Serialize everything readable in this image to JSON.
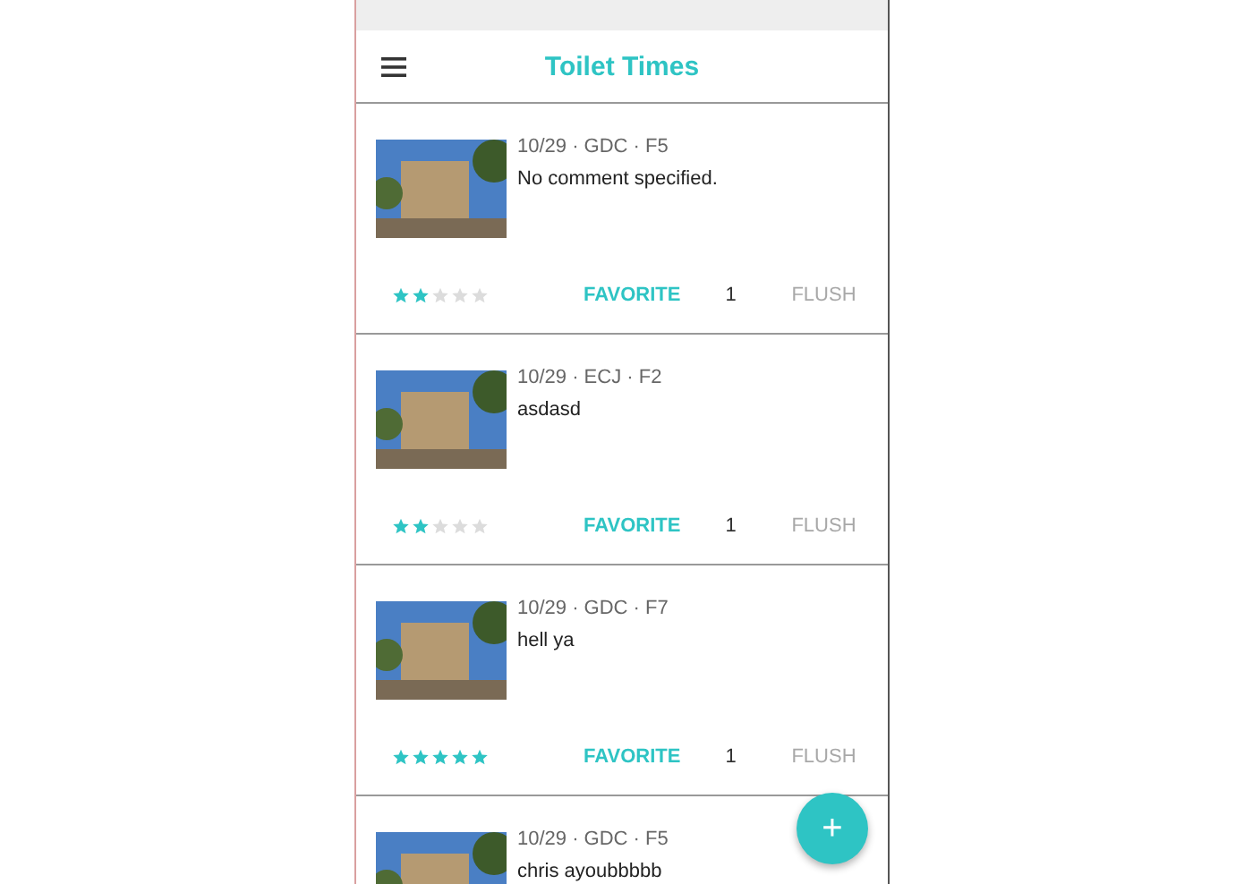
{
  "app_bar": {
    "title": "Toilet Times"
  },
  "posts": [
    {
      "meta": "10/29 · GDC · F5",
      "comment": "No comment specified.",
      "stars": 2,
      "favorite_label": "FAVORITE",
      "count": "1",
      "flush_label": "FLUSH",
      "flush_disabled": true
    },
    {
      "meta": "10/29 · ECJ · F2",
      "comment": "asdasd",
      "stars": 2,
      "favorite_label": "FAVORITE",
      "count": "1",
      "flush_label": "FLUSH",
      "flush_disabled": true
    },
    {
      "meta": "10/29 · GDC · F7",
      "comment": "hell ya",
      "stars": 5,
      "favorite_label": "FAVORITE",
      "count": "1",
      "flush_label": "FLUSH",
      "flush_disabled": true
    },
    {
      "meta": "10/29 · GDC · F5",
      "comment": "chris ayoubbbbb"
    }
  ],
  "fab": {
    "label": "+"
  }
}
